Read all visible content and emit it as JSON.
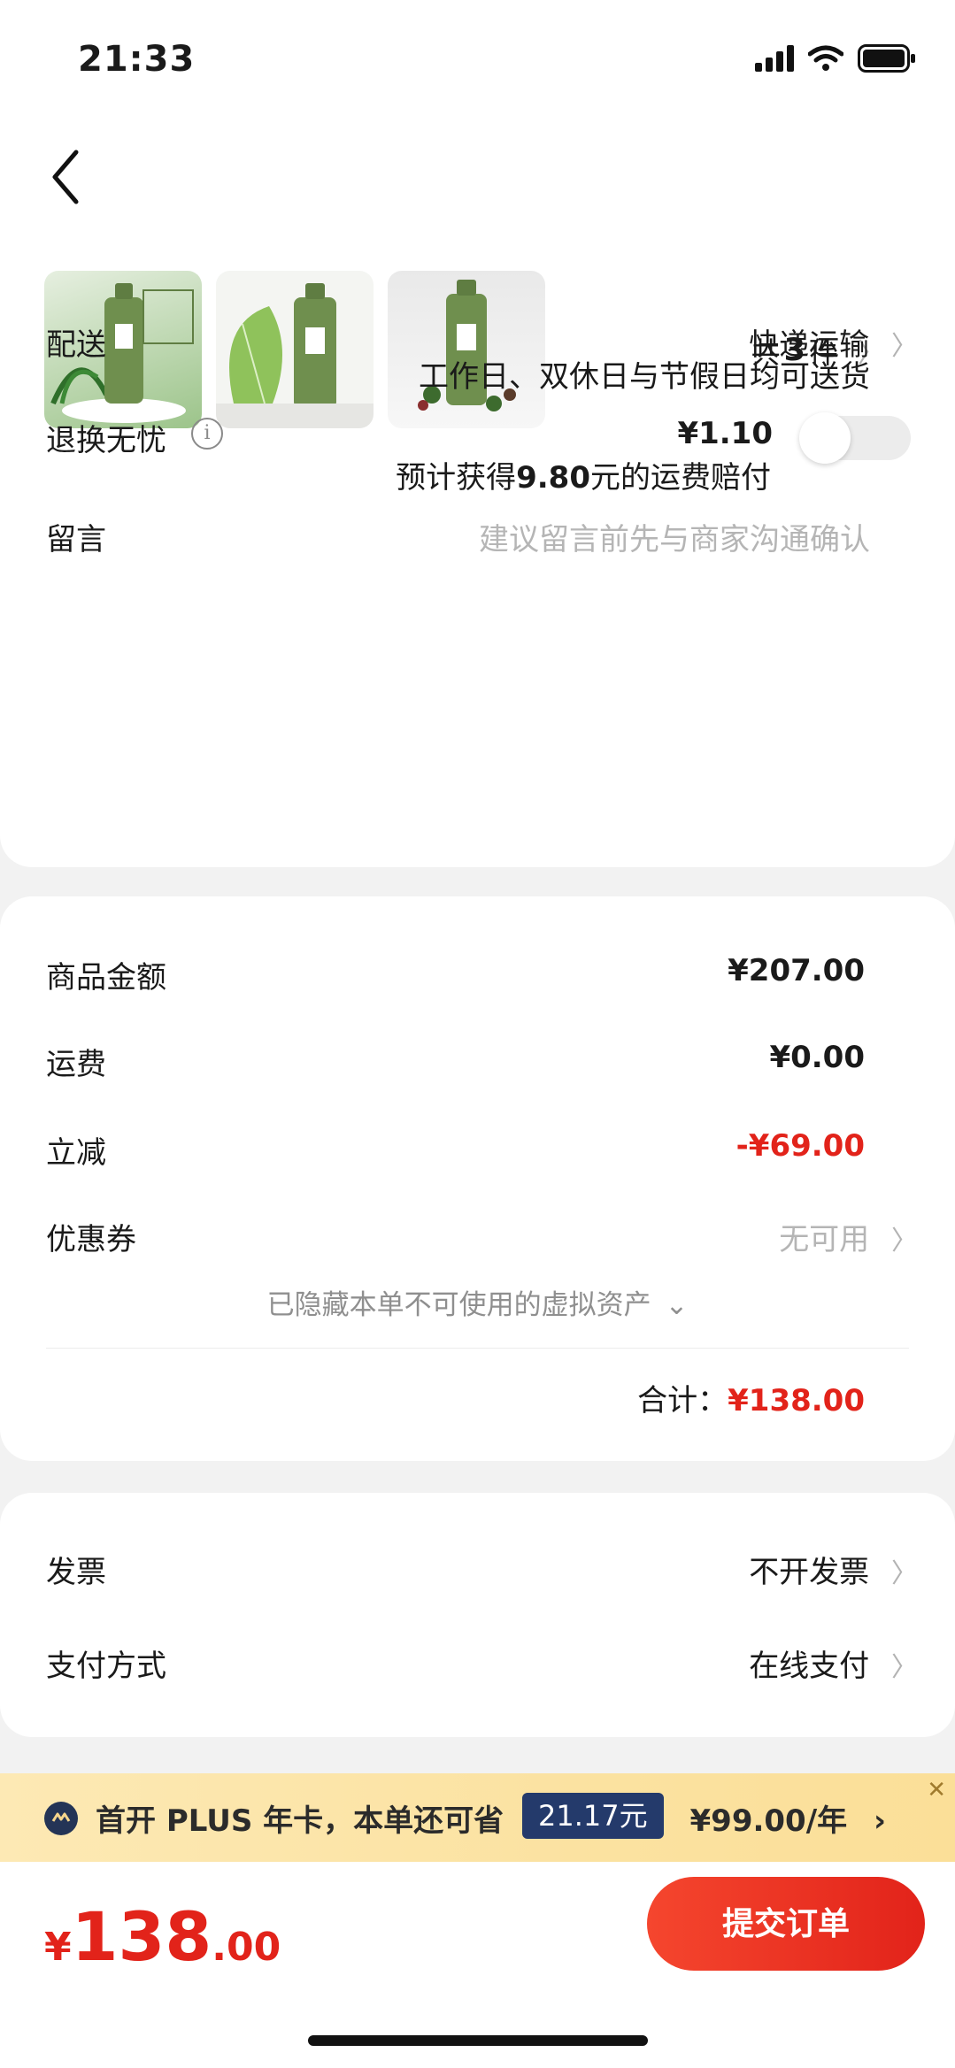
{
  "status_bar": {
    "time": "21:33"
  },
  "items": {
    "prefix": "共",
    "count": "3",
    "suffix": "件"
  },
  "delivery": {
    "label": "配送",
    "method": "快递运输",
    "note": "工作日、双休日与节假日均可送货"
  },
  "return_insurance": {
    "label": "退换无忧",
    "price": "¥1.10",
    "note_prefix": "预计获得",
    "note_amount": "9.80",
    "note_suffix": "元的运费赔付",
    "enabled": false
  },
  "message": {
    "label": "留言",
    "placeholder": "建议留言前先与商家沟通确认"
  },
  "price_summary": {
    "goods_label": "商品金额",
    "goods_value": "¥207.00",
    "shipping_label": "运费",
    "shipping_value": "¥0.00",
    "discount_label": "立减",
    "discount_value": "-¥69.00",
    "coupon_label": "优惠券",
    "coupon_value": "无可用",
    "hidden_assets": "已隐藏本单不可使用的虚拟资产",
    "total_label": "合计：",
    "total_value": "¥138.00"
  },
  "invoice": {
    "label": "发票",
    "value": "不开发票"
  },
  "payment": {
    "label": "支付方式",
    "value": "在线支付"
  },
  "plus_promo": {
    "text": "首开 PLUS 年卡，本单还可省",
    "save_amount": "21.17元",
    "price": "¥99.00/年",
    "arrow": "›",
    "close": "✕"
  },
  "bottom": {
    "currency": "¥",
    "total_int": "138",
    "total_dec": ".00",
    "submit_label": "提交订单"
  },
  "colors": {
    "accent_red": "#e2231a",
    "plus_navy": "#243a6b",
    "product_green": "#6f8f4e"
  }
}
